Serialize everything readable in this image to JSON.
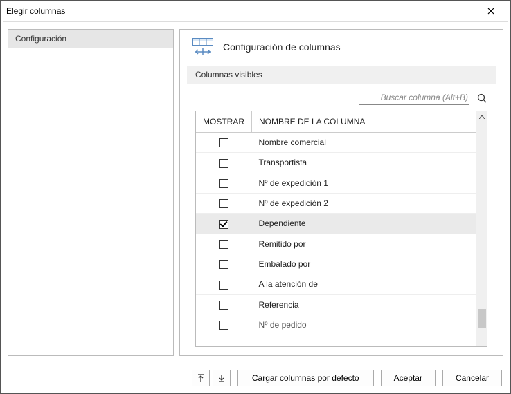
{
  "window": {
    "title": "Elegir columnas"
  },
  "sidebar": {
    "items": [
      "Configuración"
    ]
  },
  "panel": {
    "title": "Configuración de columnas",
    "section": "Columnas visibles"
  },
  "search": {
    "placeholder": "Buscar columna (Alt+B)"
  },
  "table": {
    "headers": {
      "show": "MOSTRAR",
      "name": "NOMBRE DE LA COLUMNA"
    },
    "rows": [
      {
        "checked": false,
        "label": "Nombre comercial",
        "selected": false
      },
      {
        "checked": false,
        "label": "Transportista",
        "selected": false
      },
      {
        "checked": false,
        "label": "Nº de expedición 1",
        "selected": false
      },
      {
        "checked": false,
        "label": "Nº de expedición 2",
        "selected": false
      },
      {
        "checked": true,
        "label": "Dependiente",
        "selected": true
      },
      {
        "checked": false,
        "label": "Remitido por",
        "selected": false
      },
      {
        "checked": false,
        "label": "Embalado por",
        "selected": false
      },
      {
        "checked": false,
        "label": "A la atención de",
        "selected": false
      },
      {
        "checked": false,
        "label": "Referencia",
        "selected": false
      },
      {
        "checked": false,
        "label": "Nº de pedido",
        "selected": false,
        "clipped": true
      }
    ]
  },
  "footer": {
    "load_defaults": "Cargar columnas por defecto",
    "accept": "Aceptar",
    "cancel": "Cancelar"
  }
}
